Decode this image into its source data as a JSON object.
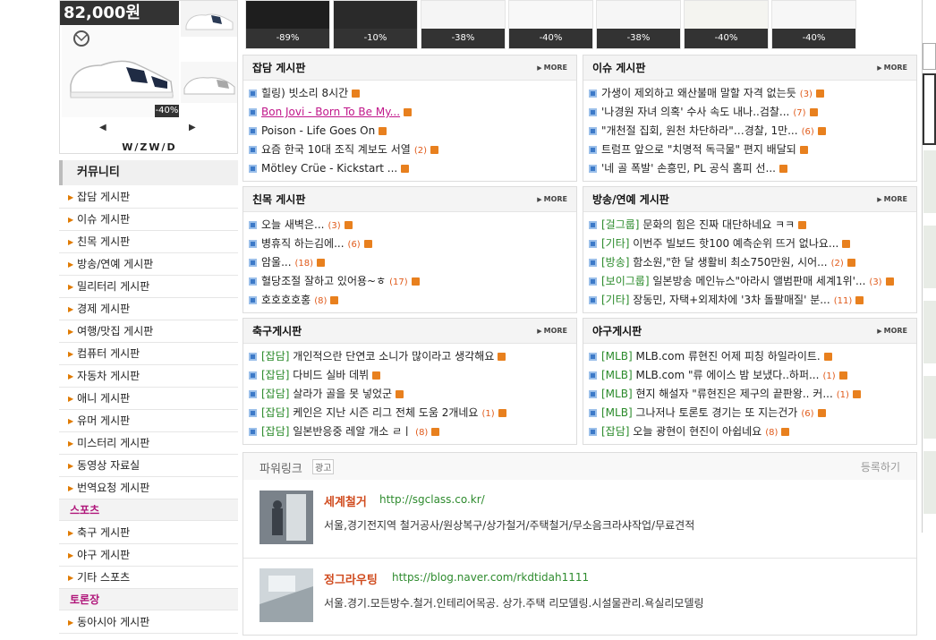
{
  "product_ad": {
    "price": "82,000원",
    "discount": "-40%",
    "brand": "W/ZW/D",
    "prev": "◀",
    "next": "▶"
  },
  "product_strip": [
    "-89%",
    "-10%",
    "-38%",
    "-40%",
    "-38%",
    "-40%",
    "-40%"
  ],
  "sidebar": {
    "title": "커뮤니티",
    "items": [
      {
        "type": "link",
        "label": "잡담 게시판"
      },
      {
        "type": "link",
        "label": "이슈 게시판"
      },
      {
        "type": "link",
        "label": "친목 게시판"
      },
      {
        "type": "link",
        "label": "방송/연예 게시판"
      },
      {
        "type": "link",
        "label": "밀리터리 게시판"
      },
      {
        "type": "link",
        "label": "경제 게시판"
      },
      {
        "type": "link",
        "label": "여행/맛집 게시판"
      },
      {
        "type": "link",
        "label": "컴퓨터 게시판"
      },
      {
        "type": "link",
        "label": "자동차 게시판"
      },
      {
        "type": "link",
        "label": "애니 게시판"
      },
      {
        "type": "link",
        "label": "유머 게시판"
      },
      {
        "type": "link",
        "label": "미스터리 게시판"
      },
      {
        "type": "link",
        "label": "동영상 자료실"
      },
      {
        "type": "link",
        "label": "번역요청 게시판"
      },
      {
        "type": "category",
        "label": "스포츠"
      },
      {
        "type": "link",
        "label": "축구 게시판"
      },
      {
        "type": "link",
        "label": "야구 게시판"
      },
      {
        "type": "link",
        "label": "기타 스포츠"
      },
      {
        "type": "category",
        "label": "토론장"
      },
      {
        "type": "link",
        "label": "동아시아 게시판"
      }
    ]
  },
  "more_label": "MORE",
  "boards": [
    {
      "title": "잡담 게시판",
      "posts": [
        {
          "tag": "",
          "text": "힐링) 빗소리 8시간",
          "count": "",
          "highlight": false
        },
        {
          "tag": "",
          "text": "Bon Jovi - Born To Be My...",
          "count": "",
          "highlight": true
        },
        {
          "tag": "",
          "text": "Poison - Life Goes On",
          "count": "",
          "highlight": false
        },
        {
          "tag": "",
          "text": "요즘 한국 10대 조직 계보도 서열",
          "count": "(2)",
          "highlight": false
        },
        {
          "tag": "",
          "text": "Mötley Crüe - Kickstart ...",
          "count": "",
          "highlight": false
        }
      ]
    },
    {
      "title": "이슈 게시판",
      "posts": [
        {
          "tag": "",
          "text": "가생이 제외하고 왜산불매 말할 자격 없는듯",
          "count": "(3)",
          "highlight": false
        },
        {
          "tag": "",
          "text": "'나경원 자녀 의혹' 수사 속도 내나..검찰...",
          "count": "(7)",
          "highlight": false
        },
        {
          "tag": "",
          "text": "\"개천절 집회, 원천 차단하라\"…경찰, 1만...",
          "count": "(6)",
          "highlight": false
        },
        {
          "tag": "",
          "text": "트럼프 앞으로 \"치명적 독극물\" 편지 배달되",
          "count": "",
          "highlight": false
        },
        {
          "tag": "",
          "text": "'네 골 폭발' 손흥민, PL 공식 홈피 선...",
          "count": "",
          "highlight": false
        }
      ]
    },
    {
      "title": "친목 게시판",
      "posts": [
        {
          "tag": "",
          "text": "오늘 새벽은...",
          "count": "(3)",
          "highlight": false
        },
        {
          "tag": "",
          "text": "병휴직 하는김에...",
          "count": "(6)",
          "highlight": false
        },
        {
          "tag": "",
          "text": "암울...",
          "count": "(18)",
          "highlight": false
        },
        {
          "tag": "",
          "text": "혈당조절 잘하고 있어용~ㅎ",
          "count": "(17)",
          "highlight": false
        },
        {
          "tag": "",
          "text": "호호호호홍",
          "count": "(8)",
          "highlight": false
        }
      ]
    },
    {
      "title": "방송/연예 게시판",
      "posts": [
        {
          "tag": "[걸그룹]",
          "text": "문화의 힘은 진짜 대단하네요 ㅋㅋ",
          "count": "",
          "highlight": false
        },
        {
          "tag": "[기타]",
          "text": "이번주 빌보드 핫100 예측순위 뜨거 없나요...",
          "count": "",
          "highlight": false
        },
        {
          "tag": "[방송]",
          "text": "함소원,\"한 달 생활비 최소750만원, 시어...",
          "count": "(2)",
          "highlight": false
        },
        {
          "tag": "[보이그룹]",
          "text": "일본방송 메인뉴스\"아라시 앨범판매 세계1위'...",
          "count": "(3)",
          "highlight": false
        },
        {
          "tag": "[기타]",
          "text": "장동민, 자택+외제차에 '3차 돌팔매질' 분...",
          "count": "(11)",
          "highlight": false
        }
      ]
    },
    {
      "title": "축구게시판",
      "posts": [
        {
          "tag": "[잡담]",
          "text": "개인적으란 단연코 소니가 많이라고 생각해요",
          "count": "",
          "highlight": false
        },
        {
          "tag": "[잡담]",
          "text": "다비드 실바 데뷔",
          "count": "",
          "highlight": false
        },
        {
          "tag": "[잡담]",
          "text": "살라가 골을 못 넣었군",
          "count": "",
          "highlight": false
        },
        {
          "tag": "[잡담]",
          "text": "케인은 지난 시즌 리그 전체 도움 2개네요",
          "count": "(1)",
          "highlight": false
        },
        {
          "tag": "[잡담]",
          "text": "일본반응중 레알 개소 ㄹㅣ",
          "count": "(8)",
          "highlight": false
        }
      ]
    },
    {
      "title": "야구게시판",
      "posts": [
        {
          "tag": "[MLB]",
          "text": "MLB.com 류현진 어제 피칭 하일라이트.",
          "count": "",
          "highlight": false
        },
        {
          "tag": "[MLB]",
          "text": "MLB.com \"류 에이스 밤 보냈다..하퍼...",
          "count": "(1)",
          "highlight": false
        },
        {
          "tag": "[MLB]",
          "text": "현지 해설자 \"류현진은 제구의 끝판왕.. 커...",
          "count": "(1)",
          "highlight": false
        },
        {
          "tag": "[MLB]",
          "text": "그나저나 토론토 경기는 또 지는건가",
          "count": "(6)",
          "highlight": false
        },
        {
          "tag": "[잡담]",
          "text": "오늘 광현이 현진이 아쉽네요",
          "count": "(8)",
          "highlight": false
        }
      ]
    }
  ],
  "powerlink": {
    "title": "파워링크",
    "badge": "광고",
    "register": "등록하기",
    "ads": [
      {
        "name": "세계철거",
        "url": "http://sgclass.co.kr/",
        "desc": "서울,경기전지역 철거공사/원상복구/상가철거/주택철거/무소음크라샤작업/무료견적"
      },
      {
        "name": "정그라우팅",
        "url": "https://blog.naver.com/rkdtidah1111",
        "desc": "서울.경기.모든방수.철거.인테리어목공. 상가.주택 리모델링.시설물관리.욕실리모델링"
      }
    ]
  }
}
